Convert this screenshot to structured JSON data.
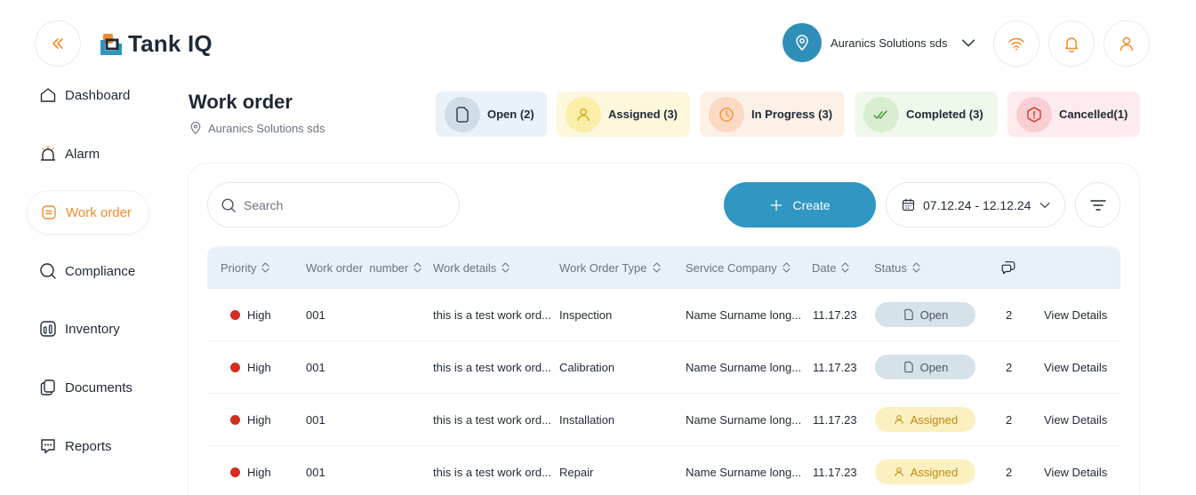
{
  "app": {
    "name": "Tank IQ",
    "company": "Auranics Solutions sds"
  },
  "colors": {
    "accent_orange": "#f28c28",
    "primary_blue": "#2f97c1",
    "priority_high": "#d62d20",
    "open_bg": "#d6e2ea",
    "assigned_bg": "#fbf0bf"
  },
  "sidebar": {
    "items": [
      {
        "label": "Dashboard",
        "icon": "home-icon"
      },
      {
        "label": "Alarm",
        "icon": "alarm-icon"
      },
      {
        "label": "Work order",
        "icon": "work-order-icon",
        "active": true
      },
      {
        "label": "Compliance",
        "icon": "compliance-icon"
      },
      {
        "label": "Inventory",
        "icon": "inventory-icon"
      },
      {
        "label": "Documents",
        "icon": "documents-icon"
      },
      {
        "label": "Reports",
        "icon": "reports-icon"
      }
    ]
  },
  "page": {
    "title": "Work order",
    "subtitle": "Auranics Solutions sds"
  },
  "status_cards": [
    {
      "label": "Open (2)",
      "icon": "document-icon"
    },
    {
      "label": "Assigned (3)",
      "icon": "user-icon"
    },
    {
      "label": "In Progress (3)",
      "icon": "clock-icon"
    },
    {
      "label": "Completed (3)",
      "icon": "double-check-icon"
    },
    {
      "label": "Cancelled(1)",
      "icon": "warning-icon"
    }
  ],
  "toolbar": {
    "search_placeholder": "Search",
    "create_label": "Create",
    "date_range": "07.12.24 - 12.12.24"
  },
  "table": {
    "columns": [
      "Priority",
      "Work order  number",
      "Work details",
      "Work Order Type",
      "Service Company",
      "Date",
      "Status"
    ],
    "comments_icon": "comments-icon",
    "rows": [
      {
        "priority": "High",
        "number": "001",
        "details": "this is a test work ord...",
        "type": "Inspection",
        "company": "Name Surname long...",
        "date": "11.17.23",
        "status": "Open",
        "comments": "2",
        "action": "View Details"
      },
      {
        "priority": "High",
        "number": "001",
        "details": "this is a test work ord...",
        "type": "Calibration",
        "company": "Name Surname long...",
        "date": "11.17.23",
        "status": "Open",
        "comments": "2",
        "action": "View Details"
      },
      {
        "priority": "High",
        "number": "001",
        "details": "this is a test work ord...",
        "type": "Installation",
        "company": "Name Surname long...",
        "date": "11.17.23",
        "status": "Assigned",
        "comments": "2",
        "action": "View Details"
      },
      {
        "priority": "High",
        "number": "001",
        "details": "this is a test work ord...",
        "type": "Repair",
        "company": "Name Surname long...",
        "date": "11.17.23",
        "status": "Assigned",
        "comments": "2",
        "action": "View Details"
      }
    ]
  }
}
